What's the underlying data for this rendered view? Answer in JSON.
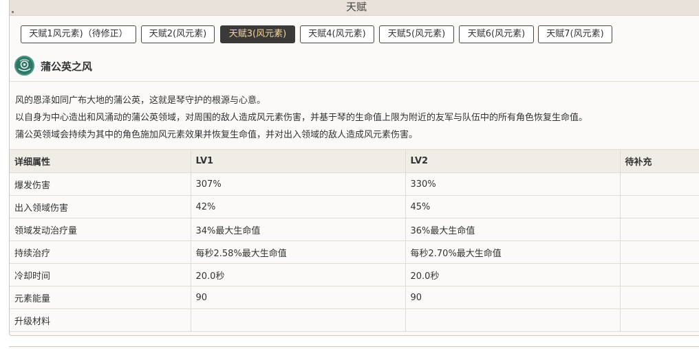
{
  "header": {
    "title": "天赋"
  },
  "tabs": [
    {
      "label": "天赋1风元素)（待修正）",
      "active": false
    },
    {
      "label": "天赋2(风元素)",
      "active": false
    },
    {
      "label": "天赋3(风元素)",
      "active": true
    },
    {
      "label": "天赋4(风元素)",
      "active": false
    },
    {
      "label": "天赋5(风元素)",
      "active": false
    },
    {
      "label": "天赋6(风元素)",
      "active": false
    },
    {
      "label": "天赋7(风元素)",
      "active": false
    }
  ],
  "skill": {
    "name": "蒲公英之风",
    "icon": "dandelion-wind-icon",
    "icon_color": "#2f7566"
  },
  "description": [
    "风的恩泽如同广布大地的蒲公英，这就是琴守护的根源与心意。",
    "以自身为中心造出和风涌动的蒲公英领域，对周围的敌人造成风元素伤害，并基于琴的生命值上限为附近的友军与队伍中的所有角色恢复生命值。",
    "蒲公英领域会持续为其中的角色施加风元素效果并恢复生命值，并对出入领域的敌人造成风元素伤害。"
  ],
  "table": {
    "headers": [
      "详细属性",
      "LV1",
      "LV2",
      "待补充"
    ],
    "rows": [
      [
        "爆发伤害",
        "307%",
        "330%",
        ""
      ],
      [
        "出入领域伤害",
        "42%",
        "45%",
        ""
      ],
      [
        "领域发动治疗量",
        "34%最大生命值",
        "36%最大生命值",
        ""
      ],
      [
        "持续治疗",
        "每秒2.58%最大生命值",
        "每秒2.70%最大生命值",
        ""
      ],
      [
        "冷却时间",
        "20.0秒",
        "20.0秒",
        ""
      ],
      [
        "元素能量",
        "90",
        "90",
        ""
      ],
      [
        "升级材料",
        "",
        "",
        ""
      ]
    ]
  },
  "colors": {
    "active_tab_bg": "#3b3a38",
    "active_tab_text": "#f3d79d",
    "header_bg": "#e8e2da"
  }
}
